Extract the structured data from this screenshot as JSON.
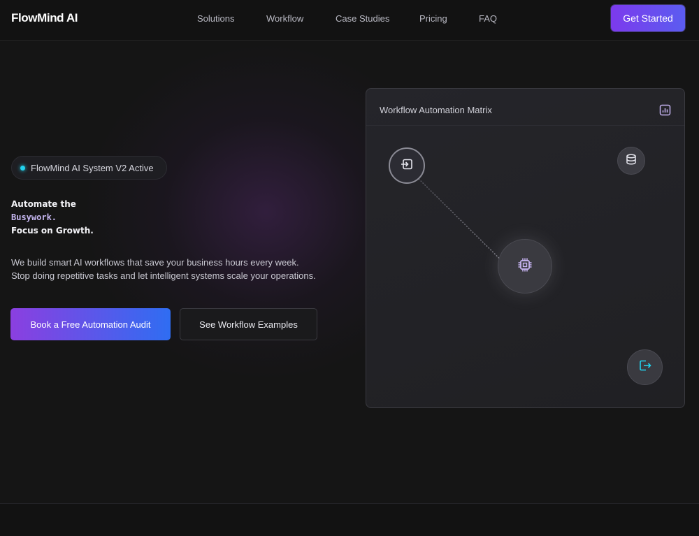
{
  "nav": {
    "logo": "FlowMind AI",
    "links": [
      "Solutions",
      "Workflow",
      "Case Studies",
      "Pricing",
      "FAQ"
    ],
    "cta_label": "Get Started"
  },
  "hero": {
    "badge": "FlowMind AI System V2 Active",
    "headline": {
      "line1": "Automate the",
      "accent": "Busywork.",
      "line3": "Focus on Growth."
    },
    "subtext": {
      "line1": "We build smart AI workflows that save your business hours every week.",
      "line2": "Stop doing repetitive tasks and let intelligent systems scale your operations."
    },
    "primary_button": "Book a Free Automation Audit",
    "secondary_button": "See Workflow Examples"
  },
  "panel": {
    "title": "Workflow Automation Matrix",
    "icons": {
      "header": "bar-chart-icon",
      "input_node": "sign-in-icon",
      "db_node": "database-icon",
      "core_node": "cpu-chip-icon",
      "output_node": "sign-out-icon"
    }
  },
  "colors": {
    "accent_purple": "#7c3aed",
    "accent_blue": "#2f6df2",
    "status_cyan": "#22d3ee",
    "panel_icon_violet": "#c9b6f5"
  }
}
